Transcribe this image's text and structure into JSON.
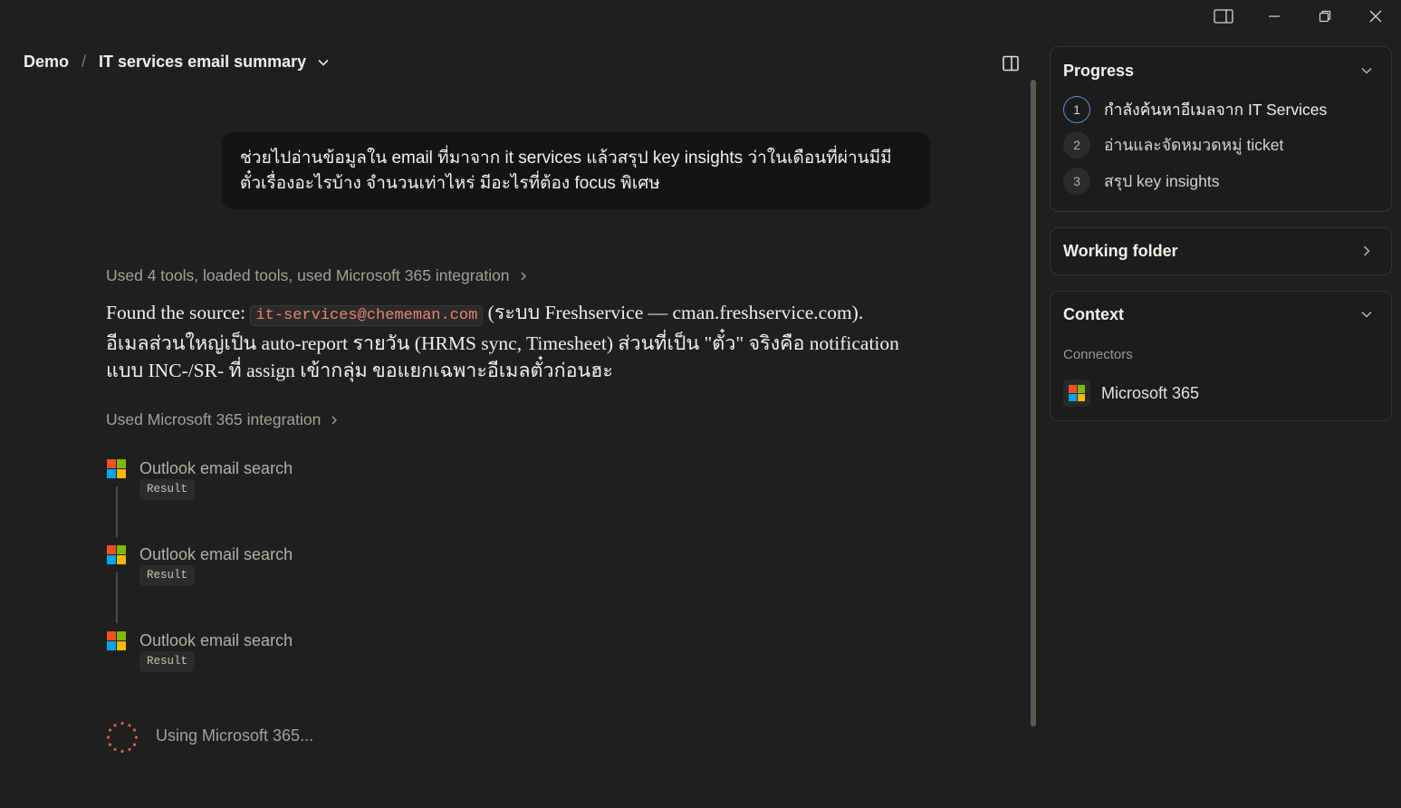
{
  "window_controls": {
    "icons": [
      "sidebar-icon",
      "minimize-icon",
      "maximize-icon",
      "close-icon"
    ]
  },
  "breadcrumb": {
    "project": "Demo",
    "separator": "/",
    "title": "IT services email summary"
  },
  "conversation": {
    "user_message": "ช่วยไปอ่านข้อมูลใน email ที่มาจาก it services แล้วสรุป key insights ว่าในเดือนที่ผ่านมีมีตั๋วเรื่องอะไรบ้าง จำนวนเท่าไหร่ มีอะไรที่ต้อง focus พิเศษ",
    "tool_summary_1": "Used 4 tools, loaded tools, used Microsoft 365 integration",
    "answer": {
      "prefix": "Found the source: ",
      "code": "it-services@chememan.com",
      "rest": " (ระบบ Freshservice — cman.freshservice.com). อีเมลส่วนใหญ่เป็น auto-report รายวัน (HRMS sync, Timesheet) ส่วนที่เป็น \"ตั๋ว\" จริงคือ notification แบบ INC-/SR- ที่ assign เข้ากลุ่ม ขอแยกเฉพาะอีเมลตั๋วก่อนฮะ"
    },
    "tool_summary_2": "Used Microsoft 365 integration",
    "tool_calls": [
      {
        "name": "Outlook email search",
        "result": "Result"
      },
      {
        "name": "Outlook email search",
        "result": "Result"
      },
      {
        "name": "Outlook email search",
        "result": "Result"
      }
    ],
    "status": "Using Microsoft 365..."
  },
  "progress": {
    "title": "Progress",
    "steps": [
      {
        "number": "1",
        "label": "กำลังค้นหาอีเมลจาก IT Services",
        "active": true
      },
      {
        "number": "2",
        "label": "อ่านและจัดหมวดหมู่ ticket",
        "active": false
      },
      {
        "number": "3",
        "label": "สรุป key insights",
        "active": false
      }
    ]
  },
  "working_folder": {
    "title": "Working folder"
  },
  "context": {
    "title": "Context",
    "connectors_label": "Connectors",
    "connectors": [
      {
        "name": "Microsoft 365",
        "icon": "microsoft-logo-icon"
      }
    ]
  },
  "colors": {
    "background": "#1f1f1e",
    "code_text": "#e9857a",
    "active_step_ring": "#5b8fd6",
    "ms_red": "#f25022",
    "ms_green": "#7fba00",
    "ms_blue": "#00a4ef",
    "ms_yellow": "#ffb900"
  }
}
